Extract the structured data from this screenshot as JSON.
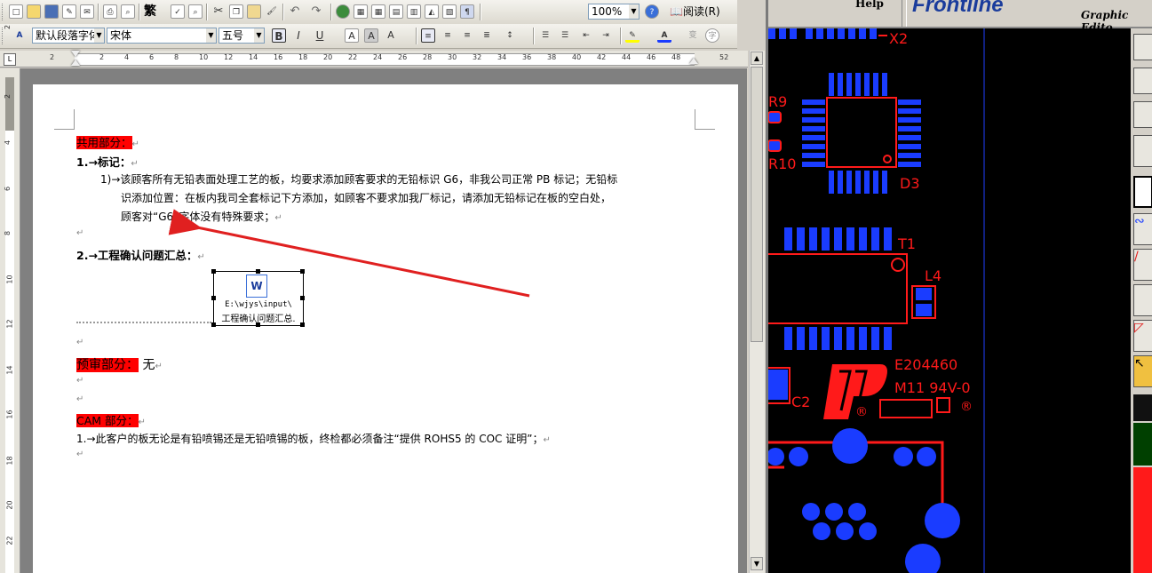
{
  "toolbar1": {
    "traditional_label": "繁",
    "zoom_value": "100%",
    "read_label": "阅读(R)"
  },
  "toolbar2": {
    "style_value": "默认段落字体",
    "font_value": "宋体",
    "size_value": "五号",
    "bold": "B",
    "italic": "I",
    "underline": "U",
    "char_border": "A",
    "char_shade": "A",
    "scale": "A",
    "font_color": "A",
    "phonetic": "变",
    "enclose": "字"
  },
  "ruler": {
    "h_ticks": [
      "2",
      "2",
      "4",
      "6",
      "8",
      "10",
      "12",
      "14",
      "16",
      "18",
      "20",
      "22",
      "24",
      "26",
      "28",
      "30",
      "32",
      "34",
      "36",
      "38",
      "40",
      "42",
      "44",
      "46",
      "48",
      "52"
    ],
    "v_ticks": [
      "2",
      "2",
      "4",
      "6",
      "8",
      "10",
      "12",
      "14",
      "16",
      "18",
      "20",
      "22"
    ]
  },
  "document": {
    "section1_title": "共用部分：",
    "item1_label": "1.→标记：",
    "item1_text_line1": "1)→该顾客所有无铅表面处理工艺的板，均要求添加顾客要求的无铅标识 G6，非我公司正常 PB 标记；无铅标",
    "item1_text_line2": "识添加位置：在板内我司全套标记下方添加，如顾客不要求加我厂标记，请添加无铅标记在板的空白处，",
    "item1_text_line3": "顾客对“G6”字体没有特殊要求；",
    "item2_label": "2.→工程确认问题汇总：",
    "embed_path": "E:\\wjys\\input\\",
    "embed_name": "工程确认问题汇总.",
    "section2_title": "预审部分：",
    "section2_value": "无",
    "section3_title": "CAM 部分：",
    "item3_text": "1.→此客户的板无论是有铅喷锡还是无铅喷锡的板，终检都必须备注“提供 ROHS5 的 COC 证明”；",
    "paragraph_mark": "↵"
  },
  "pcb": {
    "menu_help": "Help",
    "brand": "Frontline",
    "subtitle": "Graphic Edito",
    "labels": {
      "x2": "X2",
      "r9": "R9",
      "r10": "R10",
      "d3": "D3",
      "t1": "T1",
      "l4": "L4",
      "c2": "C2",
      "code1": "E204460",
      "code2": "M11 94V-0",
      "reg1": "®",
      "reg2": "®"
    }
  },
  "colors": {
    "highlight": "#ff0000",
    "pcb_blue": "#1a3cff",
    "pcb_red": "#ff1a1a",
    "arrow": "#e02020"
  }
}
